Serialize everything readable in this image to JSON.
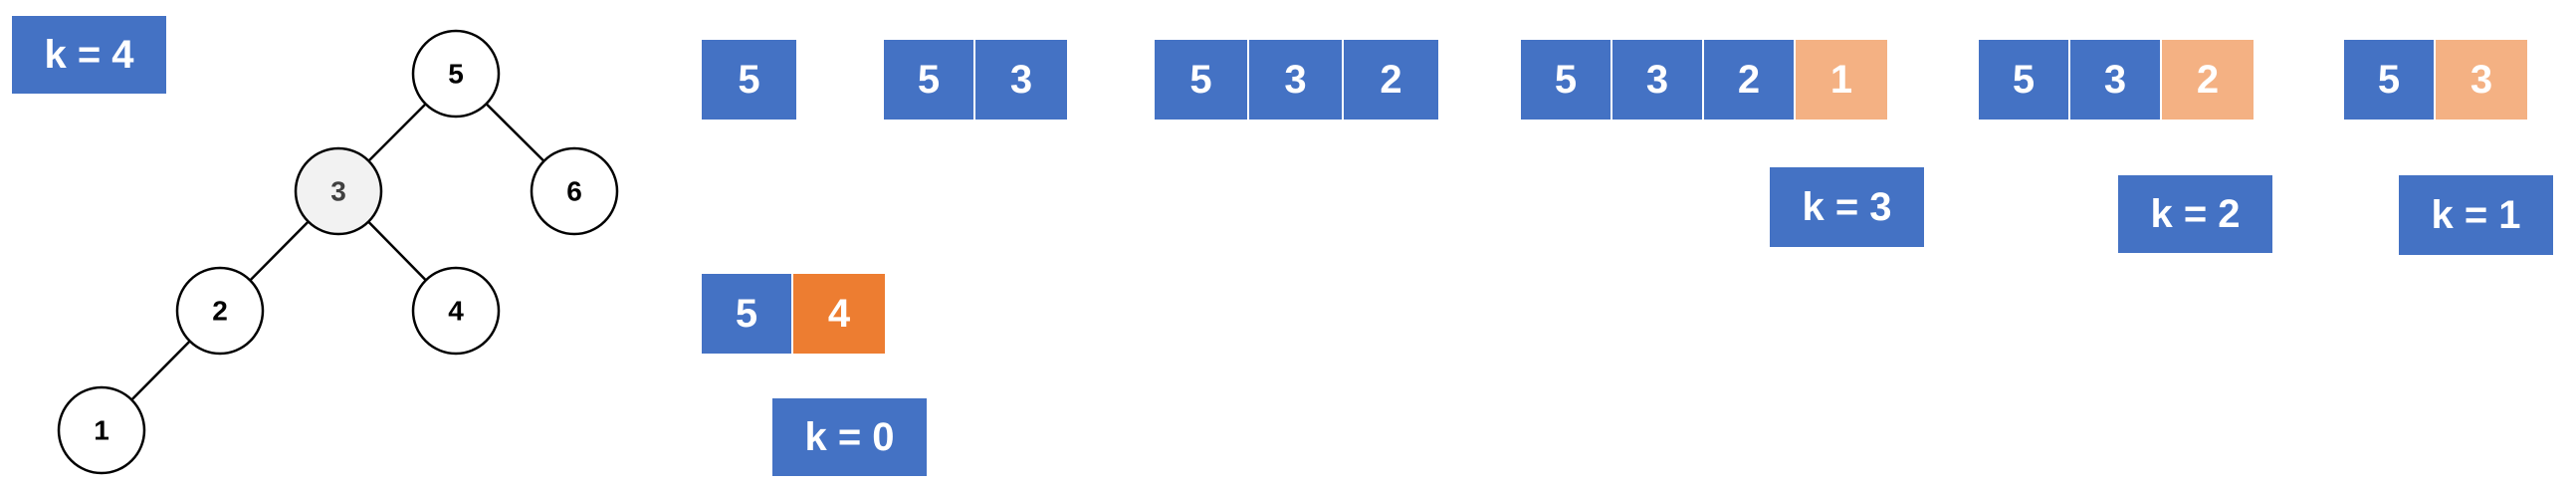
{
  "start_label": "k = 4",
  "tree": {
    "nodes": [
      {
        "id": "n5",
        "text": "5",
        "highlight": false
      },
      {
        "id": "n3",
        "text": "3",
        "highlight": true
      },
      {
        "id": "n6",
        "text": "6",
        "highlight": false
      },
      {
        "id": "n2",
        "text": "2",
        "highlight": false
      },
      {
        "id": "n4",
        "text": "4",
        "highlight": false
      },
      {
        "id": "n1",
        "text": "1",
        "highlight": false
      }
    ],
    "edges": [
      [
        "n5",
        "n3"
      ],
      [
        "n5",
        "n6"
      ],
      [
        "n3",
        "n2"
      ],
      [
        "n3",
        "n4"
      ],
      [
        "n2",
        "n1"
      ]
    ]
  },
  "sequences": [
    {
      "cells": [
        "5"
      ],
      "highlight": "none",
      "k": ""
    },
    {
      "cells": [
        "5",
        "3"
      ],
      "highlight": "none",
      "k": ""
    },
    {
      "cells": [
        "5",
        "3",
        "2"
      ],
      "highlight": "none",
      "k": ""
    },
    {
      "cells": [
        "5",
        "3",
        "2",
        "1"
      ],
      "highlight": "light",
      "k": "k = 3"
    },
    {
      "cells": [
        "5",
        "3",
        "2"
      ],
      "highlight": "light",
      "k": "k = 2"
    },
    {
      "cells": [
        "5",
        "3"
      ],
      "highlight": "light",
      "k": "k = 1"
    },
    {
      "cells": [
        "5",
        "4"
      ],
      "highlight": "dark",
      "k": "k = 0"
    }
  ],
  "colors": {
    "blue": "#4472c4",
    "light_orange": "#f4b183",
    "dark_orange": "#ed7d31",
    "node_highlight": "#f2f2f2"
  }
}
